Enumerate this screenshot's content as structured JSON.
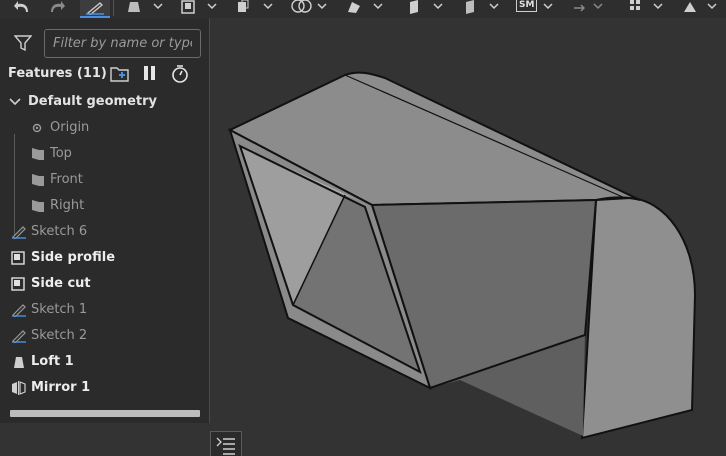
{
  "toolbar": {
    "icons": [
      "undo-icon",
      "redo-icon",
      "sketch-icon",
      "loft-icon",
      "extrude-icon",
      "boolean-icon",
      "fillet-icon",
      "plane-icon",
      "sheet-metal-icon",
      "sm-icon",
      "transform-icon",
      "pattern-icon",
      "more-icon"
    ],
    "sm_label": "SM"
  },
  "panel": {
    "filter": {
      "placeholder": "Filter by name or type"
    },
    "features_header": "Features (11)",
    "header_icons": [
      "add-folder-icon",
      "pause-icon",
      "timer-icon"
    ],
    "default_geometry_label": "Default geometry",
    "default_items": [
      {
        "label": "Origin",
        "icon": "origin-icon"
      },
      {
        "label": "Top",
        "icon": "plane-icon"
      },
      {
        "label": "Front",
        "icon": "plane-icon"
      },
      {
        "label": "Right",
        "icon": "plane-icon"
      }
    ],
    "features": [
      {
        "label": "Sketch 6",
        "icon": "sketch-icon",
        "style": "muted"
      },
      {
        "label": "Side profile",
        "icon": "extrude-icon",
        "style": "bright"
      },
      {
        "label": "Side cut",
        "icon": "extrude-icon",
        "style": "bright"
      },
      {
        "label": "Sketch 1",
        "icon": "sketch-icon",
        "style": "muted"
      },
      {
        "label": "Sketch 2",
        "icon": "sketch-icon",
        "style": "muted"
      },
      {
        "label": "Loft 1",
        "icon": "loft-icon",
        "style": "bright"
      },
      {
        "label": "Mirror 1",
        "icon": "mirror-icon",
        "style": "bright"
      }
    ]
  },
  "colors": {
    "background": "#333333",
    "panel": "#2b2b2b",
    "accent": "#4a90e2"
  }
}
